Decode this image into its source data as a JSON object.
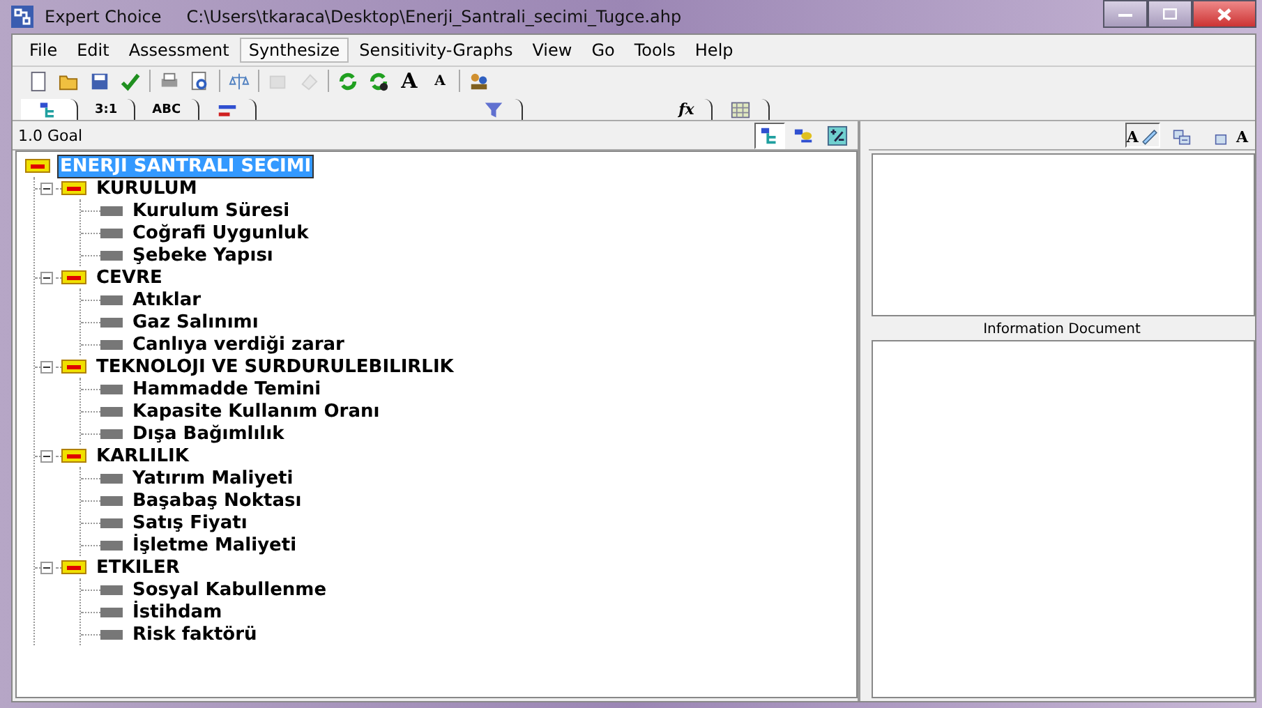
{
  "window": {
    "title": "Expert Choice",
    "path": "C:\\Users\\tkaraca\\Desktop\\Enerji_Santrali_secimi_Tugce.ahp"
  },
  "menu": [
    {
      "label": "File",
      "selected": false
    },
    {
      "label": "Edit",
      "selected": false
    },
    {
      "label": "Assessment",
      "selected": false
    },
    {
      "label": "Synthesize",
      "selected": true
    },
    {
      "label": "Sensitivity-Graphs",
      "selected": false
    },
    {
      "label": "View",
      "selected": false
    },
    {
      "label": "Go",
      "selected": false
    },
    {
      "label": "Tools",
      "selected": false
    },
    {
      "label": "Help",
      "selected": false
    }
  ],
  "toolbar": [
    {
      "kind": "new",
      "disabled": false
    },
    {
      "kind": "open",
      "disabled": false
    },
    {
      "kind": "save",
      "disabled": false
    },
    {
      "kind": "check",
      "disabled": false
    },
    {
      "kind": "sep"
    },
    {
      "kind": "print",
      "disabled": false
    },
    {
      "kind": "preview",
      "disabled": false
    },
    {
      "kind": "sep"
    },
    {
      "kind": "scale",
      "disabled": false
    },
    {
      "kind": "sep"
    },
    {
      "kind": "edit",
      "disabled": true
    },
    {
      "kind": "doc",
      "disabled": true
    },
    {
      "kind": "sep"
    },
    {
      "kind": "refresh",
      "disabled": false
    },
    {
      "kind": "refresh2",
      "disabled": false
    },
    {
      "kind": "fontup",
      "label": "A",
      "disabled": false
    },
    {
      "kind": "fontdown",
      "label": "A",
      "disabled": false
    },
    {
      "kind": "sep"
    },
    {
      "kind": "people",
      "disabled": false
    }
  ],
  "tabs": [
    {
      "kind": "tree",
      "selected": true
    },
    {
      "kind": "text",
      "label": "3:1",
      "selected": false
    },
    {
      "kind": "text",
      "label": "ABC",
      "selected": false
    },
    {
      "kind": "bars",
      "selected": false
    },
    {
      "kind": "funnel",
      "selected": false
    },
    {
      "kind": "italic",
      "label": "fx",
      "selected": false
    },
    {
      "kind": "grid",
      "selected": false
    }
  ],
  "node_bar": {
    "label": "1.0 Goal",
    "views": [
      {
        "kind": "tree",
        "selected": true
      },
      {
        "kind": "nodes",
        "selected": false
      },
      {
        "kind": "plusminus",
        "selected": false
      }
    ]
  },
  "tree": {
    "label": "ENERJI SANTRALI SECIMI",
    "selected": true,
    "children": [
      {
        "label": "KURULUM",
        "expanded": true,
        "children": [
          {
            "label": "Kurulum Süresi"
          },
          {
            "label": "Coğrafi Uygunluk"
          },
          {
            "label": "Şebeke Yapısı"
          }
        ]
      },
      {
        "label": "CEVRE",
        "expanded": true,
        "children": [
          {
            "label": "Atıklar"
          },
          {
            "label": "Gaz Salınımı"
          },
          {
            "label": "Canlıya verdiği zarar"
          }
        ]
      },
      {
        "label": "TEKNOLOJI VE SURDURULEBILIRLIK",
        "expanded": true,
        "children": [
          {
            "label": "Hammadde Temini"
          },
          {
            "label": "Kapasite Kullanım Oranı"
          },
          {
            "label": "Dışa Bağımlılık"
          }
        ]
      },
      {
        "label": "KARLILIK",
        "expanded": true,
        "children": [
          {
            "label": "Yatırım Maliyeti"
          },
          {
            "label": "Başabaş Noktası"
          },
          {
            "label": "Satış Fiyatı"
          },
          {
            "label": "İşletme Maliyeti"
          }
        ]
      },
      {
        "label": "ETKILER",
        "expanded": true,
        "children": [
          {
            "label": "Sosyal Kabullenme"
          },
          {
            "label": "İstihdam"
          },
          {
            "label": "Risk faktörü"
          }
        ]
      }
    ]
  },
  "info_pane": {
    "tools": [
      {
        "kind": "edit-text",
        "label": "A",
        "selected": true
      },
      {
        "kind": "collapse",
        "selected": false
      },
      {
        "kind": "add-text",
        "label": "A",
        "selected": false
      }
    ],
    "document_title": "Information Document"
  }
}
